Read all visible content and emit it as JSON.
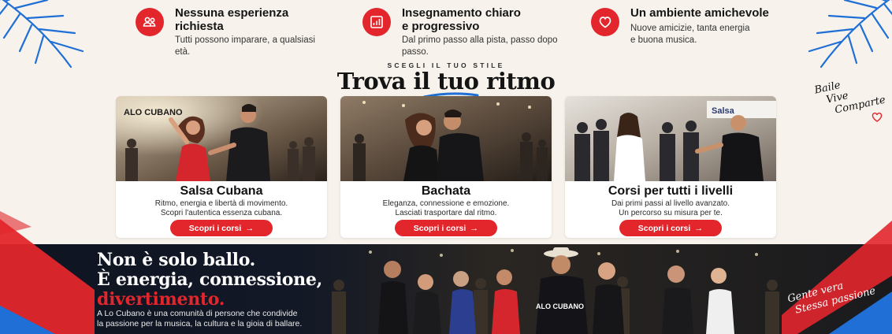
{
  "colors": {
    "accent": "#e2262c",
    "background": "#f7f3ec",
    "dark": "#0e1420",
    "leaf": "#1f6fd6"
  },
  "features": [
    {
      "icon": "group-icon",
      "title_line1": "Nessuna esperienza",
      "title_line2": "richiesta",
      "text_line1": "Tutti possono imparare, a qualsiasi età.",
      "text_line2": ""
    },
    {
      "icon": "chart-icon",
      "title_line1": "Insegnamento chiaro",
      "title_line2": "e progressivo",
      "text_line1": "Dal primo passo alla pista, passo dopo passo.",
      "text_line2": ""
    },
    {
      "icon": "heart-icon",
      "title_line1": "Un ambiente amichevole",
      "title_line2": "",
      "text_line1": "Nuove amicizie, tanta energia",
      "text_line2": "e buona musica."
    }
  ],
  "section": {
    "kicker": "SCEGLI IL TUO STILE",
    "title": "Trova il tuo ritmo"
  },
  "script_tag": {
    "line1": "Baile",
    "line2": "Vive",
    "line3": "Comparte"
  },
  "cards": [
    {
      "title": "Salsa Cubana",
      "desc_line1": "Ritmo, energia e libertà di movimento.",
      "desc_line2": "Scopri l'autentica essenza cubana.",
      "cta": "Scopri i corsi",
      "photo_sign": "ALO CUBANO"
    },
    {
      "title": "Bachata",
      "desc_line1": "Eleganza, connessione e emozione.",
      "desc_line2": "Lasciati trasportare dal ritmo.",
      "cta": "Scopri i corsi",
      "photo_sign": ""
    },
    {
      "title": "Corsi per tutti i livelli",
      "desc_line1": "Dai primi passi al livello avanzato.",
      "desc_line2": "Un percorso su misura per te.",
      "cta": "Scopri i corsi",
      "photo_sign": "Salsa"
    }
  ],
  "banner": {
    "headline_line1": "Non è solo ballo.",
    "headline_line2": "È energia, connessione,",
    "headline_line3": "divertimento.",
    "body_line1": "A Lo Cubano è una comunità di persone che condivide",
    "body_line2": "la passione per la musica, la cultura e la gioia di ballare.",
    "shirt_logo": "ALO CUBANO",
    "script_line1": "Gente vera",
    "script_line2": "Stessa passione"
  },
  "cta_arrow": "→"
}
